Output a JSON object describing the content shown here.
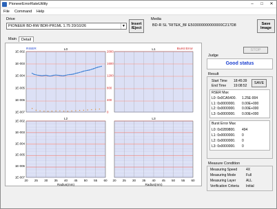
{
  "window": {
    "title": "PioneerErrorRateUtility",
    "controls": [
      "–",
      "□",
      "✕"
    ]
  },
  "menu": [
    {
      "label": "File",
      "key": "F"
    },
    {
      "label": "Command",
      "key": "C"
    },
    {
      "label": "Help",
      "key": "H"
    }
  ],
  "drive": {
    "label": "Drive",
    "value": "PIONEER BD-RW BDR-PR1ML 1.75 20/10/26",
    "insert_label_1": "Insert",
    "insert_label_2": "/Eject"
  },
  "media": {
    "label": "Media",
    "type": "BD-R SL \"RITEK_BR3\"",
    "id": "E503000000000000C217D8",
    "save_image_1": "Save",
    "save_image_2": "Image"
  },
  "tabs": {
    "main": "Main",
    "detail": "Detail"
  },
  "plots": {
    "rser_label": "RISER",
    "burst_label": "Burst Error",
    "xlabel": "Radius(mm)",
    "x_ticks": [
      "20",
      "25",
      "30",
      "35",
      "40",
      "45",
      "50",
      "55",
      "60"
    ],
    "y_ticks": [
      "1E-002",
      "1E-003",
      "1E-004",
      "1E-005",
      "1E-006",
      "1E-007"
    ],
    "y_ticks_top": [
      "1E-002",
      "1E-003",
      "1E-004",
      "1E-005",
      "1E-006",
      "1E-007"
    ],
    "burst_ticks": [
      "2000",
      "1600",
      "1200",
      "800",
      "400",
      "0"
    ],
    "titles": [
      "L0",
      "L1",
      "L2",
      "L3"
    ]
  },
  "chart_data": [
    {
      "type": "line",
      "title": "L0",
      "xlabel": "Radius(mm)",
      "ylabel": "RISER",
      "y2label": "Burst Error",
      "xlim": [
        20,
        60
      ],
      "yscale": "log",
      "ylim": [
        1e-07,
        0.01
      ],
      "y2lim": [
        0,
        2000
      ],
      "series": [
        {
          "name": "RISER",
          "color": "#3a7fd5",
          "x": [
            23,
            24,
            25,
            26,
            27,
            28,
            29,
            30,
            31,
            32,
            33,
            34,
            35,
            36,
            37,
            38,
            39,
            40,
            41,
            42,
            43,
            44,
            45,
            46,
            47,
            48,
            49,
            50,
            51,
            52,
            53,
            54,
            55,
            56,
            57,
            58
          ],
          "values": [
            0.00016,
            0.00013,
            0.00012,
            0.00011,
            0.000105,
            0.0001,
            0.000105,
            0.00011,
            0.0001,
            9.5e-05,
            0.0001,
            0.00011,
            0.000115,
            0.00011,
            0.000105,
            0.0001,
            0.0001,
            0.00011,
            0.00012,
            0.000125,
            0.00013,
            0.00014,
            0.00016,
            0.00017,
            0.00019,
            0.00021,
            0.00024,
            0.00026,
            0.00028,
            0.0003,
            0.00034,
            0.00038,
            0.00044,
            0.0005,
            0.00055,
            0.0006
          ]
        },
        {
          "name": "Burst Error",
          "color": "#e08a2a",
          "x": [
            23,
            25,
            27,
            29,
            31,
            33,
            35,
            37,
            39,
            41,
            43,
            45,
            47,
            49,
            51,
            53,
            55,
            57
          ],
          "values": [
            120,
            60,
            40,
            30,
            25,
            30,
            35,
            40,
            30,
            25,
            35,
            45,
            55,
            60,
            70,
            80,
            90,
            100
          ]
        }
      ]
    },
    {
      "type": "line",
      "title": "L1",
      "xlim": [
        20,
        60
      ],
      "yscale": "log",
      "ylim": [
        1e-07,
        0.01
      ],
      "series": []
    },
    {
      "type": "line",
      "title": "L2",
      "xlabel": "Radius(mm)",
      "xlim": [
        20,
        60
      ],
      "yscale": "log",
      "ylim": [
        1e-07,
        0.01
      ],
      "series": []
    },
    {
      "type": "line",
      "title": "L3",
      "xlabel": "Radius(mm)",
      "xlim": [
        20,
        60
      ],
      "yscale": "log",
      "ylim": [
        1e-07,
        0.01
      ],
      "series": []
    }
  ],
  "right": {
    "stop_label": "STOP",
    "judge_label": "Judge",
    "judge_value": "Good status",
    "judge_color": "#1a3fd0",
    "result_label": "Result",
    "start_time_label": "Start Time",
    "start_time": "18:45:39",
    "end_time_label": "End Time",
    "end_time": "19:08:52",
    "save_label": "SAVE",
    "rser_max_label": "RSER Max",
    "rser_rows": [
      {
        "k": "L0: 0x0CA5400.",
        "v": "1.25E-004"
      },
      {
        "k": "L1: 0x0000000.",
        "v": "0.00E+000"
      },
      {
        "k": "L2: 0x0000000.",
        "v": "0.00E+000"
      },
      {
        "k": "L3: 0x0000000.",
        "v": "0.00E+000"
      }
    ],
    "burst_max_label": "Burst Error Max",
    "burst_rows": [
      {
        "k": "L0: 0x0289800.",
        "v": "494"
      },
      {
        "k": "L1: 0x0000000.",
        "v": "0"
      },
      {
        "k": "L2: 0x0000000.",
        "v": "0"
      },
      {
        "k": "L3: 0x0000000.",
        "v": "0"
      }
    ],
    "measure_label": "Measure Condition",
    "measure_rows": [
      {
        "k": "Measuring Speed",
        "v": "4X"
      },
      {
        "k": "Measuring Mode",
        "v": "Full"
      },
      {
        "k": "Measuring Layer",
        "v": "ALL"
      },
      {
        "k": "Verification Criteria",
        "v": "Initial"
      }
    ]
  },
  "colors": {
    "plot_bg": "#eaf0fb",
    "hline_red": "#d8444a",
    "hline_purple": "#7a74c9",
    "riser_axis": "#1a3fd0",
    "burst_axis": "#d01a1a"
  }
}
